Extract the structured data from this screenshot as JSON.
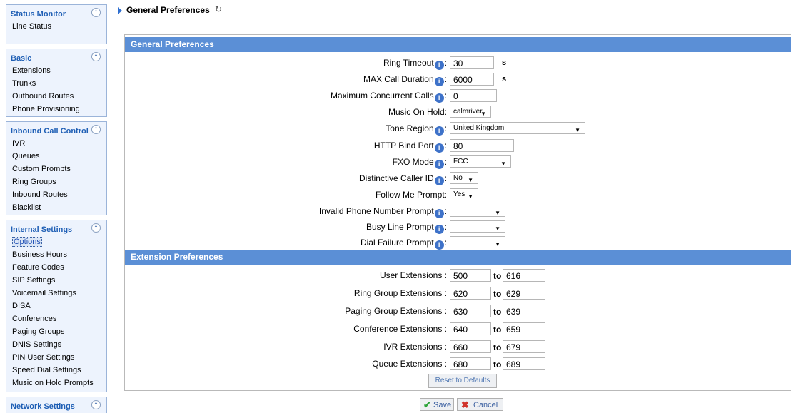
{
  "page": {
    "title": "General Preferences",
    "refresh_icon": "refresh-icon"
  },
  "sidebar": {
    "collapse_icon": "double-chevron-up-icon",
    "sections": [
      {
        "title": "Status Monitor",
        "items": [
          "Line Status"
        ]
      },
      {
        "title": "Basic",
        "items": [
          "Extensions",
          "Trunks",
          "Outbound Routes",
          "Phone Provisioning"
        ]
      },
      {
        "title": "Inbound Call Control",
        "items": [
          "IVR",
          "Queues",
          "Custom Prompts",
          "Ring Groups",
          "Inbound Routes",
          "Blacklist"
        ]
      },
      {
        "title": "Internal Settings",
        "active_item": "Options",
        "items": [
          "Options",
          "Business Hours",
          "Feature Codes",
          "SIP Settings",
          "Voicemail Settings",
          "DISA",
          "Conferences",
          "Paging Groups",
          "DNIS Settings",
          "PIN User Settings",
          "Speed Dial Settings",
          "Music on Hold Prompts"
        ]
      },
      {
        "title": "Network Settings",
        "items": []
      }
    ]
  },
  "general": {
    "header": "General Preferences",
    "ring_timeout": {
      "label": "Ring Timeout",
      "value": "30",
      "unit": "s"
    },
    "max_call_duration": {
      "label": "MAX Call Duration",
      "value": "6000",
      "unit": "s"
    },
    "max_concurrent_calls": {
      "label": "Maximum Concurrent Calls",
      "value": "0"
    },
    "music_on_hold": {
      "label": "Music On Hold:",
      "value": "calmriver"
    },
    "tone_region": {
      "label": "Tone Region",
      "value": "United Kingdom"
    },
    "http_bind_port": {
      "label": "HTTP Bind Port",
      "value": "80"
    },
    "fxo_mode": {
      "label": "FXO Mode",
      "value": "FCC"
    },
    "distinctive_caller_id": {
      "label": "Distinctive Caller ID",
      "value": "No"
    },
    "follow_me_prompt": {
      "label": "Follow Me Prompt:",
      "value": "Yes"
    },
    "invalid_phone_prompt": {
      "label": "Invalid Phone Number Prompt",
      "value": ""
    },
    "busy_line_prompt": {
      "label": "Busy Line Prompt",
      "value": ""
    },
    "dial_failure_prompt": {
      "label": "Dial Failure Prompt",
      "value": ""
    }
  },
  "extension": {
    "header": "Extension Preferences",
    "to_label": "to",
    "rows": [
      {
        "label": "User Extensions :",
        "from": "500",
        "to": "616"
      },
      {
        "label": "Ring Group Extensions :",
        "from": "620",
        "to": "629"
      },
      {
        "label": "Paging Group Extensions :",
        "from": "630",
        "to": "639"
      },
      {
        "label": "Conference Extensions :",
        "from": "640",
        "to": "659"
      },
      {
        "label": "IVR Extensions :",
        "from": "660",
        "to": "679"
      },
      {
        "label": "Queue Extensions :",
        "from": "680",
        "to": "689"
      }
    ],
    "reset_label": "Reset to Defaults"
  },
  "actions": {
    "save_label": "Save",
    "cancel_label": "Cancel"
  },
  "info_icon_glyph": "i",
  "colors": {
    "section_header": "#5b8fd6",
    "sidebar_bg": "#edf3fd",
    "sidebar_title": "#1f5fb5"
  }
}
